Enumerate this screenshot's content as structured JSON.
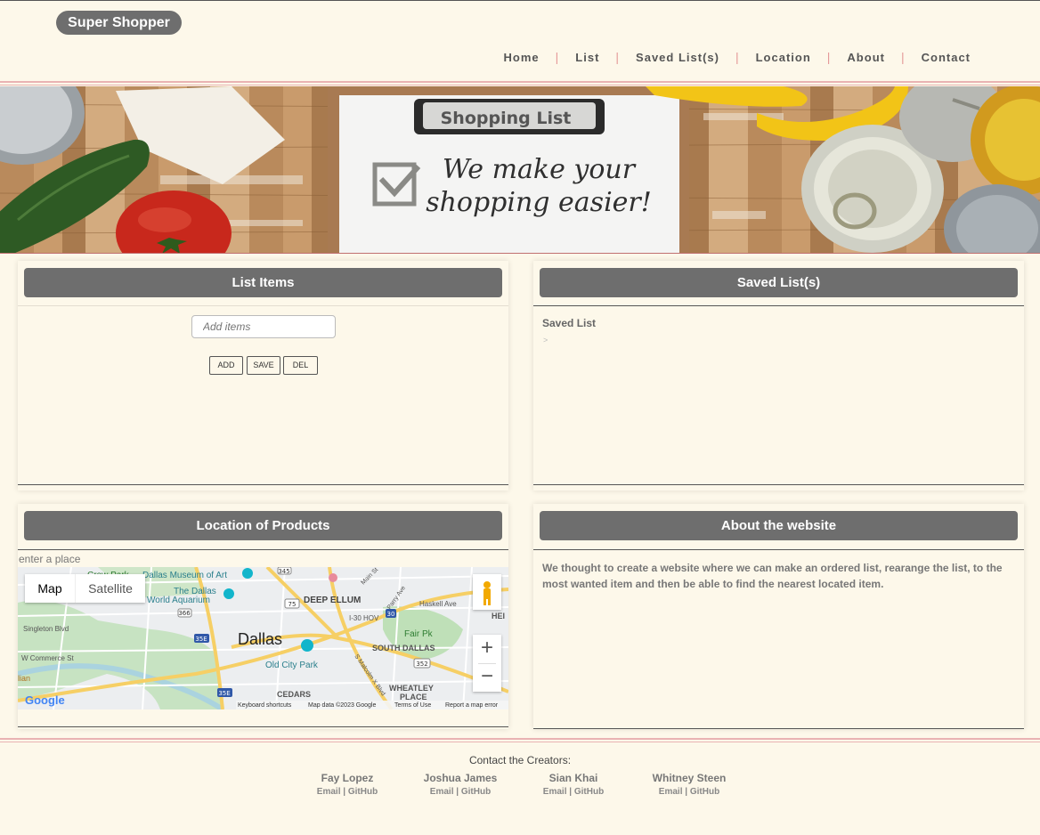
{
  "brand": "Super Shopper",
  "nav": {
    "items": [
      "Home",
      "List",
      "Saved List(s)",
      "Location",
      "About",
      "Contact"
    ],
    "separator": "|"
  },
  "hero": {
    "clipboard_title": "Shopping List",
    "tagline_line1": "We make your",
    "tagline_line2": "shopping easier!"
  },
  "list_card": {
    "title": "List Items",
    "input_placeholder": "Add items",
    "buttons": {
      "add": "ADD",
      "save": "SAVE",
      "del": "DEL"
    }
  },
  "saved_card": {
    "title": "Saved List(s)",
    "list_name": "Saved List",
    "arrow": ">"
  },
  "location_card": {
    "title": "Location of Products",
    "place_placeholder": "enter a place",
    "map": {
      "type_buttons": [
        "Map",
        "Satellite"
      ],
      "city": "Dallas",
      "labels": [
        "Dallas Museum of Art",
        "The Dallas",
        "World Aquarium",
        "DEEP ELLUM",
        "Fair Pk",
        "SOUTH DALLAS",
        "Old City Park",
        "CEDARS",
        "WHEATLEY",
        "PLACE",
        "Singleton Blvd",
        "W Commerce St",
        "Crow Park",
        "Haskell Ave",
        "I-30 HOV",
        "S Malcolm X Blvd",
        "Parry Ave",
        "Main St",
        "HEI",
        "lian"
      ],
      "route_shields": [
        "345",
        "366",
        "35E",
        "75",
        "30",
        "352",
        "35E"
      ],
      "zoom_in": "+",
      "zoom_out": "−",
      "google": "Google",
      "footer": [
        "Keyboard shortcuts",
        "Map data ©2023 Google",
        "Terms of Use",
        "Report a map error"
      ]
    }
  },
  "about_card": {
    "title": "About the website",
    "text": "We thought to create a website where we can make an ordered list, rearange the list, to the most wanted item and then be able to find the nearest located item."
  },
  "footer": {
    "heading": "Contact the Creators:",
    "creators": [
      {
        "name": "Fay Lopez",
        "email": "Email",
        "github": "GitHub"
      },
      {
        "name": "Joshua James",
        "email": "Email",
        "github": "GitHub"
      },
      {
        "name": "Sian Khai",
        "email": "Email",
        "github": "GitHub"
      },
      {
        "name": "Whitney Steen",
        "email": "Email",
        "github": "GitHub"
      }
    ],
    "link_separator": "|"
  },
  "colors": {
    "background": "#fdf8ea",
    "card_title": "#6e6e6e",
    "accent_line": "#e9b3b3",
    "nav_separator": "#e59a9a"
  }
}
